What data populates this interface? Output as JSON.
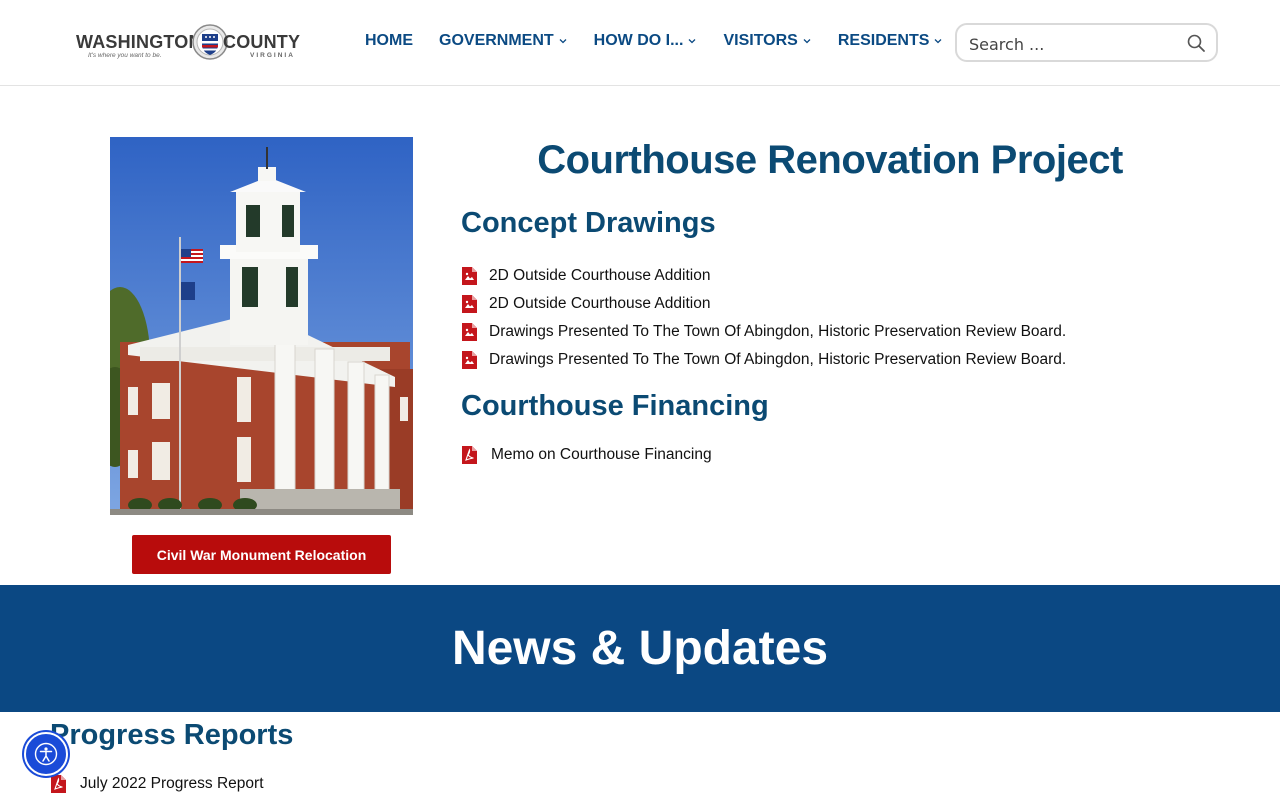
{
  "logo": {
    "left_word": "WASHINGTON",
    "right_word": "COUNTY",
    "tagline": "It's where you want to be.",
    "state": "VIRGINIA"
  },
  "nav": {
    "items": [
      {
        "label": "HOME",
        "has_dropdown": false
      },
      {
        "label": "GOVERNMENT",
        "has_dropdown": true
      },
      {
        "label": "HOW DO I...",
        "has_dropdown": true
      },
      {
        "label": "VISITORS",
        "has_dropdown": true
      },
      {
        "label": "RESIDENTS",
        "has_dropdown": true
      }
    ]
  },
  "search": {
    "placeholder": "Search ..."
  },
  "main": {
    "title": "Courthouse Renovation Project",
    "cta_label": "Civil War Monument Relocation",
    "sections": {
      "concept": {
        "heading": "Concept Drawings",
        "items": [
          "2D Outside Courthouse Addition",
          "2D Outside Courthouse Addition",
          "Drawings Presented To The Town Of Abingdon, Historic Preservation Review Board.",
          "Drawings Presented To The Town Of Abingdon, Historic Preservation Review Board."
        ]
      },
      "financing": {
        "heading": "Courthouse Financing",
        "items": [
          "Memo on Courthouse Financing"
        ]
      }
    }
  },
  "news": {
    "title": "News & Updates"
  },
  "progress": {
    "heading": "Progress Reports",
    "items": [
      "July 2022 Progress Report"
    ]
  },
  "colors": {
    "brand_blue": "#0b4883",
    "heading_blue": "#0b4a73",
    "cta_red": "#b80c0c",
    "pdf_red": "#c4161c",
    "a11y_blue": "#1a4bd8"
  },
  "icons": {
    "search": "search-icon",
    "pdf": "pdf-file-icon",
    "image_file": "image-file-icon",
    "chevron": "chevron-down-icon",
    "accessibility": "accessibility-icon"
  }
}
